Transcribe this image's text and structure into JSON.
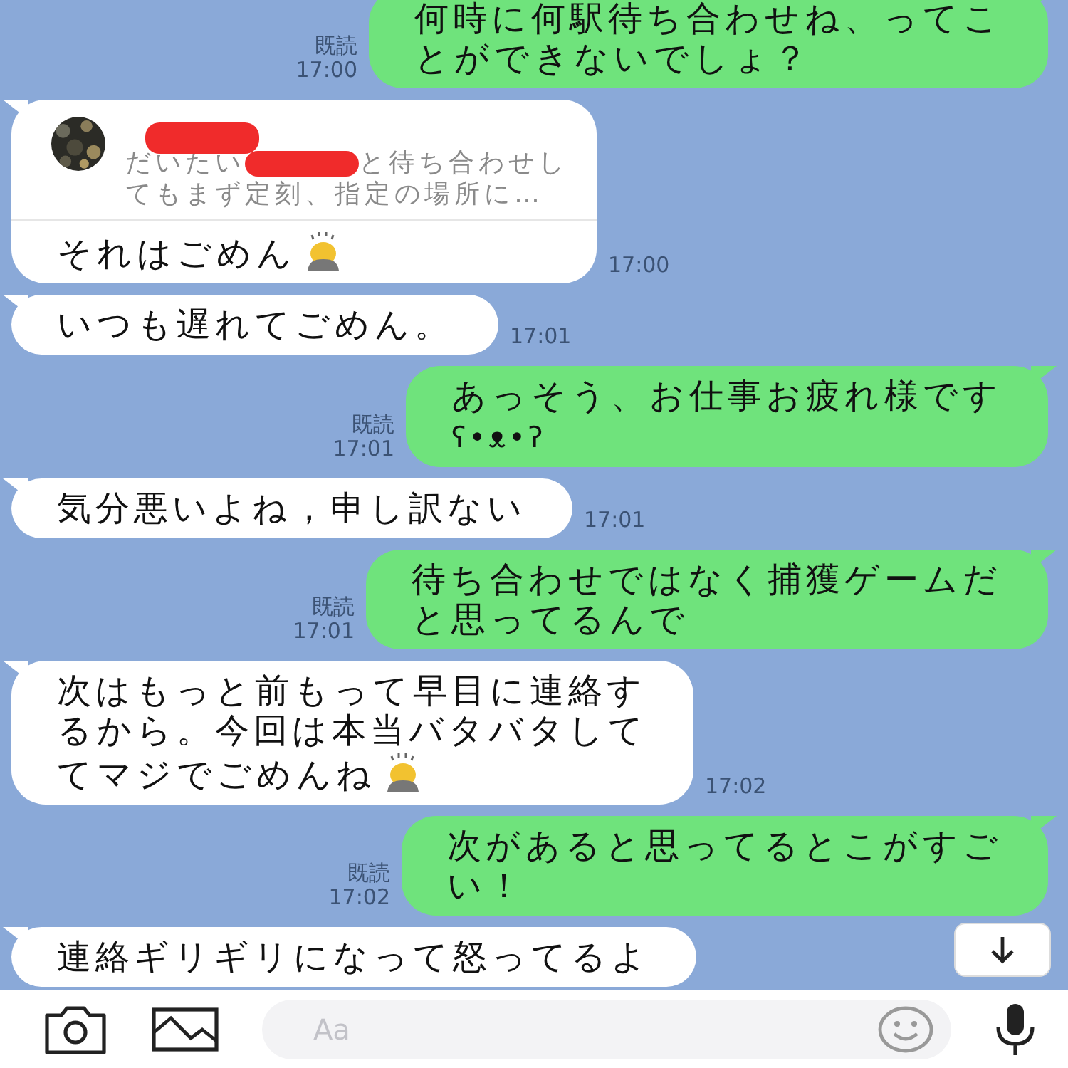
{
  "messages": [
    {
      "kind": "sent",
      "lines": [
        "何時に何駅待ち合わせね、ってこ",
        "とができないでしょ？"
      ],
      "read": "既読",
      "time": "17:00"
    },
    {
      "kind": "reply",
      "quote": {
        "before": "だいたい",
        "after_line1": "と待ち合わせし",
        "line2": "てもまず定刻、指定の場所に…"
      },
      "lines": [
        "それはごめん"
      ],
      "time": "17:00",
      "bow_icon": true
    },
    {
      "kind": "received",
      "lines": [
        "いつも遅れてごめん。"
      ],
      "time": "17:01"
    },
    {
      "kind": "sent",
      "lines": [
        "あっそう、お仕事お疲れ様です",
        "ʕ•ᴥ•ʔ"
      ],
      "read": "既読",
      "time": "17:01"
    },
    {
      "kind": "received",
      "lines": [
        "気分悪いよね，申し訳ない"
      ],
      "time": "17:01"
    },
    {
      "kind": "sent",
      "lines": [
        "待ち合わせではなく捕獲ゲームだ",
        "と思ってるんで"
      ],
      "read": "既読",
      "time": "17:01"
    },
    {
      "kind": "received",
      "lines": [
        "次はもっと前もって早目に連絡す",
        "るから。今回は本当バタバタして",
        "てマジでごめんね"
      ],
      "time": "17:02",
      "bow_icon": true
    },
    {
      "kind": "sent",
      "lines": [
        "次があると思ってるとこがすご",
        "い！"
      ],
      "read": "既読",
      "time": "17:02"
    },
    {
      "kind": "received",
      "lines": [
        "連絡ギリギリになって怒ってるよ"
      ]
    }
  ],
  "input": {
    "placeholder": "Aa"
  }
}
